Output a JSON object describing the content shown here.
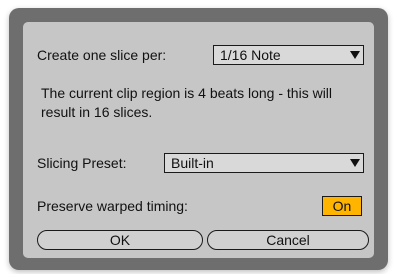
{
  "slice_setting": {
    "label": "Create one slice per:",
    "value": "1/16 Note"
  },
  "info_text": "The current clip region is 4 beats long - this will result in 16 slices.",
  "preset": {
    "label": "Slicing Preset:",
    "value": "Built-in"
  },
  "warp": {
    "label": "Preserve warped timing:",
    "toggle": "On"
  },
  "buttons": {
    "ok": "OK",
    "cancel": "Cancel"
  },
  "colors": {
    "toggle_on": "#ffb400",
    "panel": "#c6c6c6",
    "frame": "#6e6e6e"
  }
}
